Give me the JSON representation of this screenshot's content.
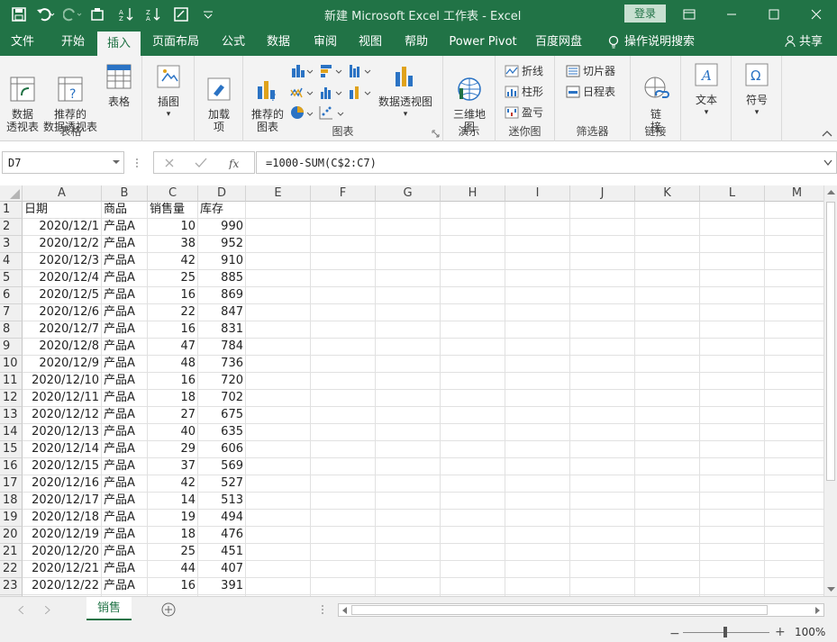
{
  "titlebar": {
    "title": "新建 Microsoft Excel 工作表 - Excel",
    "login": "登录"
  },
  "tabs": [
    "文件",
    "开始",
    "插入",
    "页面布局",
    "公式",
    "数据",
    "审阅",
    "视图",
    "帮助",
    "Power Pivot",
    "百度网盘",
    "操作说明搜索",
    "共享"
  ],
  "ribbon": {
    "tables": {
      "pivot": "数据\n透视表",
      "recommended_pivot": "推荐的\n数据透视表",
      "table": "表格",
      "label": "表格"
    },
    "illustrations": {
      "label": "插图"
    },
    "addins": {
      "label": "加载\n项"
    },
    "charts": {
      "recommended": "推荐的\n图表",
      "pivot_chart": "数据透视图",
      "label": "图表"
    },
    "tours": {
      "map3d": "三维地\n图",
      "label": "演示"
    },
    "sparklines": {
      "line": "折线",
      "column": "柱形",
      "winloss": "盈亏",
      "label": "迷你图"
    },
    "filters": {
      "slicer": "切片器",
      "timeline": "日程表",
      "label": "筛选器"
    },
    "links": {
      "link": "链\n接",
      "label": "链接"
    },
    "text": {
      "label": "文本"
    },
    "symbols": {
      "label": "符号"
    }
  },
  "formula_bar": {
    "name_box": "D7",
    "formula": "=1000-SUM(C$2:C7)"
  },
  "columns": [
    "A",
    "B",
    "C",
    "D",
    "E",
    "F",
    "G",
    "H",
    "I",
    "J",
    "K",
    "L",
    "M"
  ],
  "rows": [
    [
      "日期",
      "商品",
      "销售量",
      "库存"
    ],
    [
      "2020/12/1",
      "产品A",
      "10",
      "990"
    ],
    [
      "2020/12/2",
      "产品A",
      "38",
      "952"
    ],
    [
      "2020/12/3",
      "产品A",
      "42",
      "910"
    ],
    [
      "2020/12/4",
      "产品A",
      "25",
      "885"
    ],
    [
      "2020/12/5",
      "产品A",
      "16",
      "869"
    ],
    [
      "2020/12/6",
      "产品A",
      "22",
      "847"
    ],
    [
      "2020/12/7",
      "产品A",
      "16",
      "831"
    ],
    [
      "2020/12/8",
      "产品A",
      "47",
      "784"
    ],
    [
      "2020/12/9",
      "产品A",
      "48",
      "736"
    ],
    [
      "2020/12/10",
      "产品A",
      "16",
      "720"
    ],
    [
      "2020/12/11",
      "产品A",
      "18",
      "702"
    ],
    [
      "2020/12/12",
      "产品A",
      "27",
      "675"
    ],
    [
      "2020/12/13",
      "产品A",
      "40",
      "635"
    ],
    [
      "2020/12/14",
      "产品A",
      "29",
      "606"
    ],
    [
      "2020/12/15",
      "产品A",
      "37",
      "569"
    ],
    [
      "2020/12/16",
      "产品A",
      "42",
      "527"
    ],
    [
      "2020/12/17",
      "产品A",
      "14",
      "513"
    ],
    [
      "2020/12/18",
      "产品A",
      "19",
      "494"
    ],
    [
      "2020/12/19",
      "产品A",
      "18",
      "476"
    ],
    [
      "2020/12/20",
      "产品A",
      "25",
      "451"
    ],
    [
      "2020/12/21",
      "产品A",
      "44",
      "407"
    ],
    [
      "2020/12/22",
      "产品A",
      "16",
      "391"
    ]
  ],
  "sheet_tab": "销售",
  "zoom": "100%",
  "colors": {
    "excel_green": "#217346"
  }
}
